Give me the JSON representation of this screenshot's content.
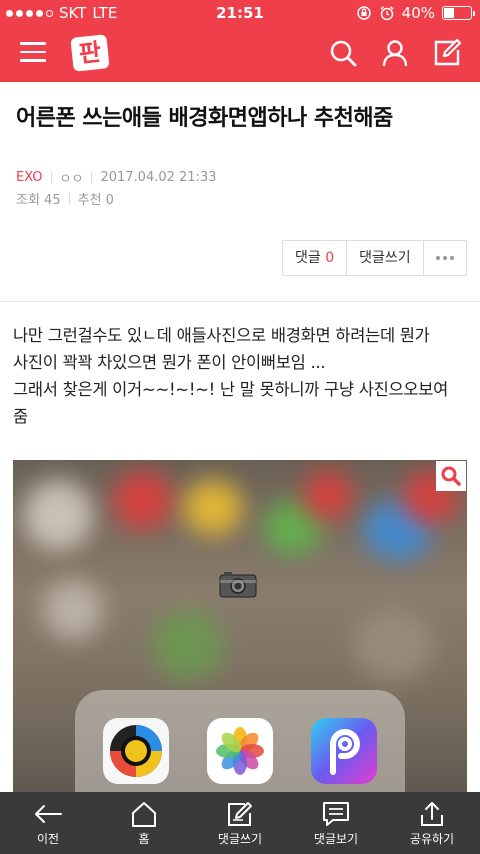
{
  "status_bar": {
    "carrier": "SKT",
    "network": "LTE",
    "time": "21:51",
    "battery": "40%",
    "battery_level": 0.4,
    "signal_bars": 4
  },
  "header": {
    "logo": "판",
    "icons": [
      "menu-icon",
      "search-icon",
      "user-icon",
      "compose-icon"
    ]
  },
  "article": {
    "title": "어른폰 쓰는애들 배경화면앱하나 추천해줌",
    "category": "EXO",
    "author": "ㅇㅇ",
    "date": "2017.04.02 21:33",
    "views_label": "조회 45",
    "recommend_label": "추천 0",
    "body_lines": [
      "나만 그런걸수도 있ㄴ데 애들사진으로 배경화면 하려는데 뭔가",
      "사진이 꽉꽉 차있으면 뭔가 폰이 안이뻐보임 ...",
      "그래서 찾은게 이거~~!~!~! 난 말 못하니까 구냥 사진으오보여",
      "줌"
    ]
  },
  "actions": {
    "comments_label": "댓글",
    "comments_count": "0",
    "write_comment_label": "댓글쓰기"
  },
  "bottom_bar": [
    {
      "label": "이전",
      "icon": "back-arrow-icon"
    },
    {
      "label": "홈",
      "icon": "home-icon"
    },
    {
      "label": "댓글쓰기",
      "icon": "write-icon"
    },
    {
      "label": "댓글보기",
      "icon": "comment-icon"
    },
    {
      "label": "공유하기",
      "icon": "share-icon"
    }
  ],
  "colors": {
    "brand": "#ef3f4a",
    "toolbar": "#3a3a3a"
  }
}
